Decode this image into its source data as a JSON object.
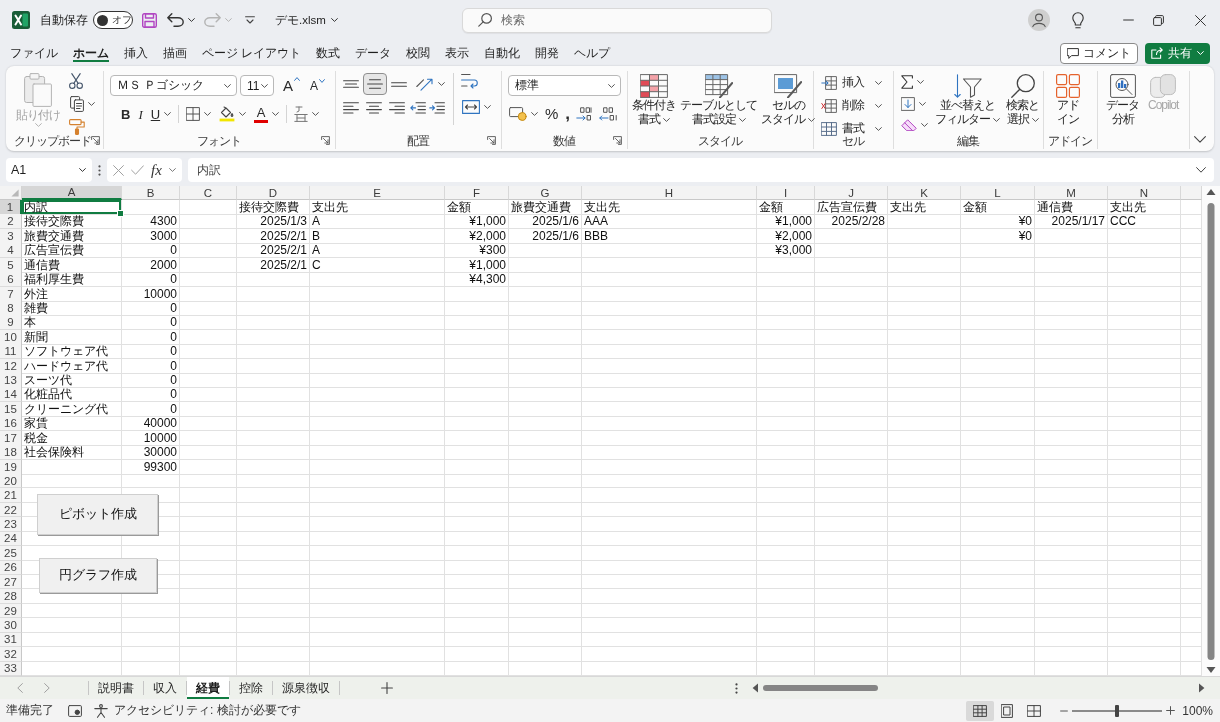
{
  "title_bar": {
    "autosave": {
      "label": "自動保存",
      "on": false,
      "state_label": "オフ"
    },
    "undo": {
      "disabled": false
    },
    "redo": {
      "disabled": true
    },
    "file_name": "デモ.xlsm",
    "search": {
      "placeholder": "検索"
    }
  },
  "menu_tabs": [
    {
      "label": "ファイル",
      "selected": false
    },
    {
      "label": "ホーム",
      "selected": true
    },
    {
      "label": "挿入",
      "selected": false
    },
    {
      "label": "描画",
      "selected": false
    },
    {
      "label": "ページ レイアウト",
      "selected": false
    },
    {
      "label": "数式",
      "selected": false
    },
    {
      "label": "データ",
      "selected": false
    },
    {
      "label": "校閲",
      "selected": false
    },
    {
      "label": "表示",
      "selected": false
    },
    {
      "label": "自動化",
      "selected": false
    },
    {
      "label": "開発",
      "selected": false
    },
    {
      "label": "ヘルプ",
      "selected": false
    }
  ],
  "comment_button": "コメント",
  "share_button": "共有",
  "ribbon": {
    "groups": [
      {
        "kind": "clipboard",
        "label": "クリップボード",
        "launcher": true,
        "paste": {
          "label": "貼り付け",
          "disabled": true
        }
      },
      {
        "kind": "font",
        "label": "フォント",
        "launcher": true,
        "font_name": "ＭＳ Ｐゴシック",
        "font_size": "11",
        "grow_glyph": "A",
        "shrink_glyph": "A",
        "bold": "B",
        "italic": "I",
        "underline": "U",
        "font_color_glyph": "A"
      },
      {
        "kind": "alignment",
        "label": "配置",
        "launcher": true,
        "vertical_align": [
          {
            "selected": false
          },
          {
            "selected": true
          },
          {
            "selected": false
          }
        ],
        "horizontal_align": [
          {
            "selected": false
          },
          {
            "selected": false
          },
          {
            "selected": false
          }
        ]
      },
      {
        "kind": "number",
        "label": "数値",
        "launcher": true,
        "format": "標準",
        "percent_glyph": "%",
        "comma_glyph": ","
      },
      {
        "kind": "styles",
        "label": "スタイル",
        "buttons": [
          {
            "lines": [
              "条件付き",
              "書式"
            ]
          },
          {
            "lines": [
              "テーブルとして",
              "書式設定"
            ]
          },
          {
            "lines": [
              "セルの",
              "スタイル"
            ]
          }
        ]
      },
      {
        "kind": "cells",
        "label": "セル",
        "buttons": [
          "挿入",
          "削除",
          "書式"
        ]
      },
      {
        "kind": "editing",
        "label": "編集",
        "buttons": [
          {
            "lines": [
              "並べ替えと",
              "フィルター"
            ]
          },
          {
            "lines": [
              "検索と",
              "選択"
            ]
          }
        ]
      },
      {
        "kind": "addins",
        "label": "アドイン",
        "buttons": [
          {
            "lines": [
              "アド",
              "イン"
            ]
          }
        ]
      },
      {
        "kind": "analysis",
        "buttons": [
          {
            "lines": [
              "データ",
              "分析"
            ],
            "disabled": false
          },
          {
            "lines": [
              "Copilot"
            ],
            "disabled": true
          }
        ]
      }
    ]
  },
  "formula_bar": {
    "name_box": "A1",
    "function_label": "fx",
    "formula": "内訳"
  },
  "sheet": {
    "columns": [
      {
        "label": "A",
        "selected": true
      },
      {
        "label": "B",
        "selected": false
      },
      {
        "label": "C",
        "selected": false
      },
      {
        "label": "D",
        "selected": false
      },
      {
        "label": "E",
        "selected": false
      },
      {
        "label": "F",
        "selected": false
      },
      {
        "label": "G",
        "selected": false
      },
      {
        "label": "H",
        "selected": false
      },
      {
        "label": "I",
        "selected": false
      },
      {
        "label": "J",
        "selected": false
      },
      {
        "label": "K",
        "selected": false
      },
      {
        "label": "L",
        "selected": false
      },
      {
        "label": "M",
        "selected": false
      },
      {
        "label": "N",
        "selected": false
      }
    ],
    "rows": [
      {
        "number": "1",
        "selected": true,
        "cells": [
          {
            "kind": "text",
            "text": "内訳"
          },
          null,
          null,
          {
            "kind": "text",
            "text": "接待交際費"
          },
          {
            "kind": "text",
            "text": "支出先"
          },
          {
            "kind": "text",
            "text": "金額"
          },
          {
            "kind": "text",
            "text": "旅費交通費"
          },
          {
            "kind": "text",
            "text": "支出先"
          },
          {
            "kind": "text",
            "text": "金額"
          },
          {
            "kind": "text",
            "text": "広告宣伝費"
          },
          {
            "kind": "text",
            "text": "支出先"
          },
          {
            "kind": "text",
            "text": "金額"
          },
          {
            "kind": "text",
            "text": "通信費"
          },
          {
            "kind": "text",
            "text": "支出先"
          }
        ]
      },
      {
        "number": "2",
        "selected": false,
        "cells": [
          {
            "kind": "text",
            "text": "接待交際費"
          },
          {
            "kind": "number",
            "text": "4300"
          },
          null,
          {
            "kind": "number",
            "text": "2025/1/3"
          },
          {
            "kind": "text",
            "text": "A"
          },
          {
            "kind": "number",
            "text": "¥1,000"
          },
          {
            "kind": "number",
            "text": "2025/1/6"
          },
          {
            "kind": "text",
            "text": "AAA"
          },
          {
            "kind": "number",
            "text": "¥1,000"
          },
          {
            "kind": "number",
            "text": "2025/2/28"
          },
          null,
          {
            "kind": "number",
            "text": "¥0"
          },
          {
            "kind": "number",
            "text": "2025/1/17"
          },
          {
            "kind": "text",
            "text": "CCC"
          }
        ]
      },
      {
        "number": "3",
        "selected": false,
        "cells": [
          {
            "kind": "text",
            "text": "旅費交通費"
          },
          {
            "kind": "number",
            "text": "3000"
          },
          null,
          {
            "kind": "number",
            "text": "2025/2/1"
          },
          {
            "kind": "text",
            "text": "B"
          },
          {
            "kind": "number",
            "text": "¥2,000"
          },
          {
            "kind": "number",
            "text": "2025/1/6"
          },
          {
            "kind": "text",
            "text": "BBB"
          },
          {
            "kind": "number",
            "text": "¥2,000"
          },
          null,
          null,
          {
            "kind": "number",
            "text": "¥0"
          }
        ]
      },
      {
        "number": "4",
        "selected": false,
        "cells": [
          {
            "kind": "text",
            "text": "広告宣伝費"
          },
          {
            "kind": "number",
            "text": "0"
          },
          null,
          {
            "kind": "number",
            "text": "2025/2/1"
          },
          {
            "kind": "text",
            "text": "A"
          },
          {
            "kind": "number",
            "text": "¥300"
          },
          null,
          null,
          {
            "kind": "number",
            "text": "¥3,000"
          }
        ]
      },
      {
        "number": "5",
        "selected": false,
        "cells": [
          {
            "kind": "text",
            "text": "通信費"
          },
          {
            "kind": "number",
            "text": "2000"
          },
          null,
          {
            "kind": "number",
            "text": "2025/2/1"
          },
          {
            "kind": "text",
            "text": "C"
          },
          {
            "kind": "number",
            "text": "¥1,000"
          }
        ]
      },
      {
        "number": "6",
        "selected": false,
        "cells": [
          {
            "kind": "text",
            "text": "福利厚生費"
          },
          {
            "kind": "number",
            "text": "0"
          },
          null,
          null,
          null,
          {
            "kind": "number",
            "text": "¥4,300"
          }
        ]
      },
      {
        "number": "7",
        "selected": false,
        "cells": [
          {
            "kind": "text",
            "text": "外注"
          },
          {
            "kind": "number",
            "text": "10000"
          }
        ]
      },
      {
        "number": "8",
        "selected": false,
        "cells": [
          {
            "kind": "text",
            "text": "雑費"
          },
          {
            "kind": "number",
            "text": "0"
          }
        ]
      },
      {
        "number": "9",
        "selected": false,
        "cells": [
          {
            "kind": "text",
            "text": "本"
          },
          {
            "kind": "number",
            "text": "0"
          }
        ]
      },
      {
        "number": "10",
        "selected": false,
        "cells": [
          {
            "kind": "text",
            "text": "新聞"
          },
          {
            "kind": "number",
            "text": "0"
          }
        ]
      },
      {
        "number": "11",
        "selected": false,
        "cells": [
          {
            "kind": "text",
            "text": "ソフトウェア代"
          },
          {
            "kind": "number",
            "text": "0"
          }
        ]
      },
      {
        "number": "12",
        "selected": false,
        "cells": [
          {
            "kind": "text",
            "text": "ハードウェア代"
          },
          {
            "kind": "number",
            "text": "0"
          }
        ]
      },
      {
        "number": "13",
        "selected": false,
        "cells": [
          {
            "kind": "text",
            "text": "スーツ代"
          },
          {
            "kind": "number",
            "text": "0"
          }
        ]
      },
      {
        "number": "14",
        "selected": false,
        "cells": [
          {
            "kind": "text",
            "text": "化粧品代"
          },
          {
            "kind": "number",
            "text": "0"
          }
        ]
      },
      {
        "number": "15",
        "selected": false,
        "cells": [
          {
            "kind": "text",
            "text": "クリーニング代"
          },
          {
            "kind": "number",
            "text": "0"
          }
        ]
      },
      {
        "number": "16",
        "selected": false,
        "cells": [
          {
            "kind": "text",
            "text": "家賃"
          },
          {
            "kind": "number",
            "text": "40000"
          }
        ]
      },
      {
        "number": "17",
        "selected": false,
        "cells": [
          {
            "kind": "text",
            "text": "税金"
          },
          {
            "kind": "number",
            "text": "10000"
          }
        ]
      },
      {
        "number": "18",
        "selected": false,
        "cells": [
          {
            "kind": "text",
            "text": "社会保険料"
          },
          {
            "kind": "number",
            "text": "30000"
          }
        ]
      },
      {
        "number": "19",
        "selected": false,
        "cells": [
          null,
          {
            "kind": "number",
            "text": "99300"
          }
        ]
      },
      {
        "number": "20",
        "selected": false
      },
      {
        "number": "21",
        "selected": false
      },
      {
        "number": "22",
        "selected": false
      },
      {
        "number": "23",
        "selected": false
      },
      {
        "number": "24",
        "selected": false
      },
      {
        "number": "25",
        "selected": false
      },
      {
        "number": "26",
        "selected": false
      },
      {
        "number": "27",
        "selected": false
      },
      {
        "number": "28",
        "selected": false
      },
      {
        "number": "29",
        "selected": false
      },
      {
        "number": "30",
        "selected": false
      },
      {
        "number": "31",
        "selected": false
      },
      {
        "number": "32",
        "selected": false
      },
      {
        "number": "33",
        "selected": false
      }
    ],
    "buttons": [
      {
        "label": "ピボット作成"
      },
      {
        "label": "円グラフ作成"
      }
    ]
  },
  "sheet_tabs": [
    {
      "label": "説明書",
      "selected": false
    },
    {
      "label": "収入",
      "selected": false
    },
    {
      "label": "経費",
      "selected": true
    },
    {
      "label": "控除",
      "selected": false
    },
    {
      "label": "源泉徴収",
      "selected": false
    }
  ],
  "status_bar": {
    "status": "準備完了",
    "accessibility": "アクセシビリティ: 検討が必要です",
    "views": [
      {
        "selected": true
      },
      {
        "selected": false
      },
      {
        "selected": false
      }
    ],
    "zoom": {
      "level": 0.5,
      "label": "100%"
    }
  }
}
